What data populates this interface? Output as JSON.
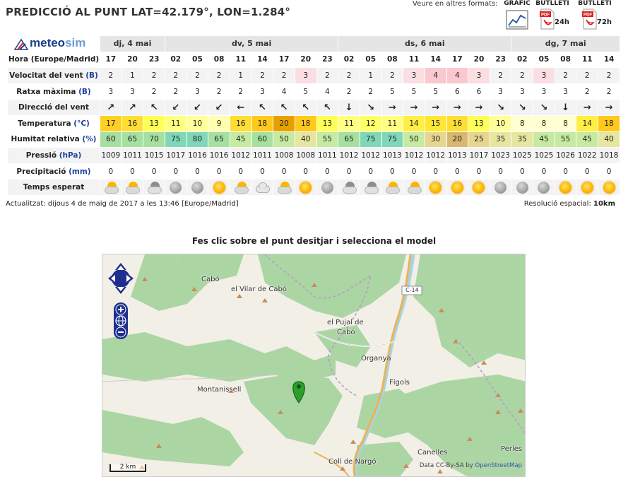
{
  "header": {
    "title": "PREDICCIÓ AL PUNT LAT=42.179°, LON=1.284°",
    "other_formats_label": "Veure en altres formats:",
    "formats": [
      {
        "label": "GRÀFIC",
        "icon": "chart-icon",
        "sub": ""
      },
      {
        "label": "BUTLLETÍ",
        "icon": "pdf-icon",
        "sub": "24h"
      },
      {
        "label": "BUTLLETÍ",
        "icon": "pdf-icon",
        "sub": "72h"
      }
    ]
  },
  "logo": {
    "part1": "meteo",
    "part2": "sim"
  },
  "days": [
    {
      "label": "dj, 4 mai",
      "span": 3
    },
    {
      "label": "dv, 5 mai",
      "span": 8
    },
    {
      "label": "ds, 6 mai",
      "span": 8
    },
    {
      "label": "dg, 7 mai",
      "span": 5
    }
  ],
  "rows": {
    "hours_label": "Hora (Europe/Madrid)",
    "hours": [
      "17",
      "20",
      "23",
      "02",
      "05",
      "08",
      "11",
      "14",
      "17",
      "20",
      "23",
      "02",
      "05",
      "08",
      "11",
      "14",
      "17",
      "20",
      "23",
      "02",
      "05",
      "08",
      "11",
      "14"
    ],
    "wind_label": "Velocitat del vent",
    "wind_unit": "(B)",
    "wind": [
      "2",
      "1",
      "2",
      "2",
      "2",
      "2",
      "1",
      "2",
      "2",
      "3",
      "2",
      "2",
      "1",
      "2",
      "3",
      "4",
      "4",
      "3",
      "2",
      "2",
      "3",
      "2",
      "2",
      "2"
    ],
    "gust_label": "Ratxa màxima",
    "gust_unit": "(B)",
    "gust": [
      "3",
      "3",
      "2",
      "2",
      "3",
      "2",
      "2",
      "3",
      "4",
      "5",
      "4",
      "2",
      "2",
      "5",
      "5",
      "5",
      "6",
      "6",
      "3",
      "3",
      "3",
      "3",
      "2",
      "2"
    ],
    "dir_label": "Direcció del vent",
    "dir": [
      "↗",
      "↗",
      "↖",
      "↙",
      "↙",
      "↙",
      "←",
      "↖",
      "↖",
      "↖",
      "↖",
      "↓",
      "↘",
      "→",
      "→",
      "→",
      "→",
      "→",
      "↘",
      "↘",
      "↘",
      "↓",
      "→",
      "→"
    ],
    "temp_label": "Temperatura",
    "temp_unit": "(°C)",
    "temp": [
      "17",
      "16",
      "13",
      "11",
      "10",
      "9",
      "16",
      "18",
      "20",
      "18",
      "13",
      "11",
      "12",
      "11",
      "14",
      "15",
      "16",
      "13",
      "10",
      "8",
      "8",
      "8",
      "14",
      "18"
    ],
    "hum_label": "Humitat relativa",
    "hum_unit": "(%)",
    "hum": [
      "60",
      "65",
      "70",
      "75",
      "80",
      "65",
      "45",
      "60",
      "50",
      "40",
      "55",
      "65",
      "75",
      "75",
      "50",
      "30",
      "20",
      "25",
      "35",
      "35",
      "45",
      "55",
      "45",
      "40"
    ],
    "press_label": "Pressió",
    "press_unit": "(hPa)",
    "press": [
      "1009",
      "1011",
      "1015",
      "1017",
      "1016",
      "1016",
      "1012",
      "1011",
      "1008",
      "1008",
      "1011",
      "1012",
      "1012",
      "1013",
      "1012",
      "1012",
      "1013",
      "1017",
      "1023",
      "1025",
      "1025",
      "1026",
      "1022",
      "1018"
    ],
    "precip_label": "Precipitació",
    "precip_unit": "(mm)",
    "precip": [
      "0",
      "0",
      "0",
      "0",
      "0",
      "0",
      "0",
      "0",
      "0",
      "0",
      "0",
      "0",
      "0",
      "0",
      "0",
      "0",
      "0",
      "0",
      "0",
      "0",
      "0",
      "0",
      "0",
      "0"
    ],
    "sky_label": "Temps esperat",
    "sky": [
      "psun",
      "psun",
      "pmoon",
      "moon",
      "moon",
      "sun",
      "psun",
      "cloud",
      "psun",
      "sun",
      "moon",
      "pmoon",
      "pmoon",
      "psun",
      "psun",
      "sun",
      "sun",
      "sun",
      "moon",
      "moon",
      "moon",
      "sun",
      "sun",
      "sun"
    ]
  },
  "footer": {
    "updated": "Actualitzat: dijous 4 de maig de 2017 a les 13:46 [Europe/Madrid]",
    "resolution_label": "Resolució espacial:",
    "resolution_value": "10km"
  },
  "map": {
    "title": "Fes clic sobre el punt desitjar i selecciona el model",
    "labels": [
      "Cabó",
      "el Vilar de Cabó",
      "el Pujal de",
      "Cabó",
      "Organyà",
      "Fígols",
      "Montanissell",
      "Canelles",
      "Perles",
      "Coll de Nargó",
      "C-14"
    ],
    "scale": "2 km",
    "attribution": "Data CC-By-SA by",
    "attribution_link": "OpenStreetMap"
  },
  "colors": {
    "temp_scale": {
      "8": "#ffffcc",
      "9": "#ffffbb",
      "10": "#ffff99",
      "11": "#ffff88",
      "12": "#ffff77",
      "13": "#ffff66",
      "14": "#ffee55",
      "15": "#ffe640",
      "16": "#ffdd33",
      "17": "#ffd633",
      "18": "#ffcc22",
      "20": "#ee9f00"
    },
    "hum_green": "#9fe09f",
    "hum_teal": "#88ddbb",
    "hum_tan": "#e8cc88"
  }
}
